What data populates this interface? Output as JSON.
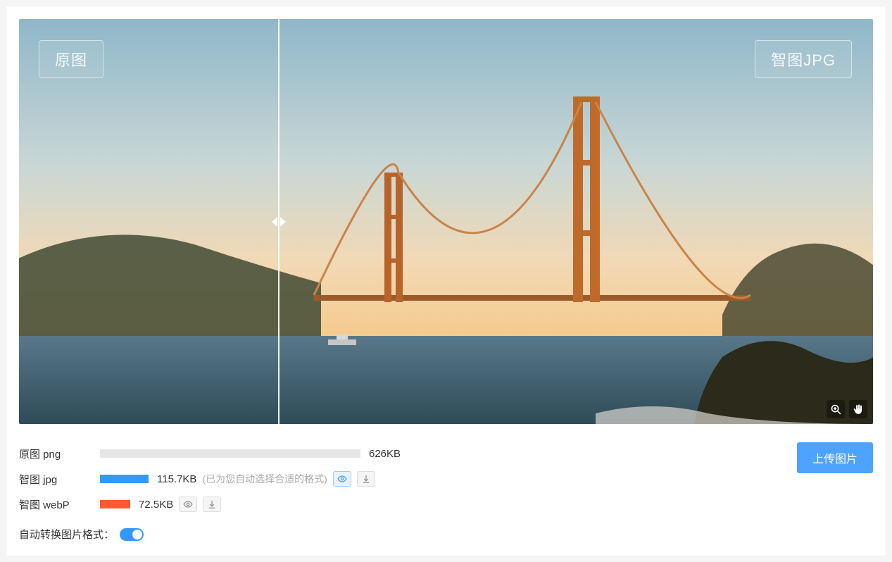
{
  "preview": {
    "left_badge": "原图",
    "right_badge": "智图JPG"
  },
  "stats": {
    "original": {
      "label": "原图 png",
      "size": "626KB"
    },
    "jpg": {
      "label": "智图 jpg",
      "size": "115.7KB",
      "hint": "(已为您自动选择合适的格式)"
    },
    "webp": {
      "label": "智图 webP",
      "size": "72.5KB"
    }
  },
  "auto_convert": {
    "label": "自动转换图片格式："
  },
  "upload_button": "上传图片"
}
